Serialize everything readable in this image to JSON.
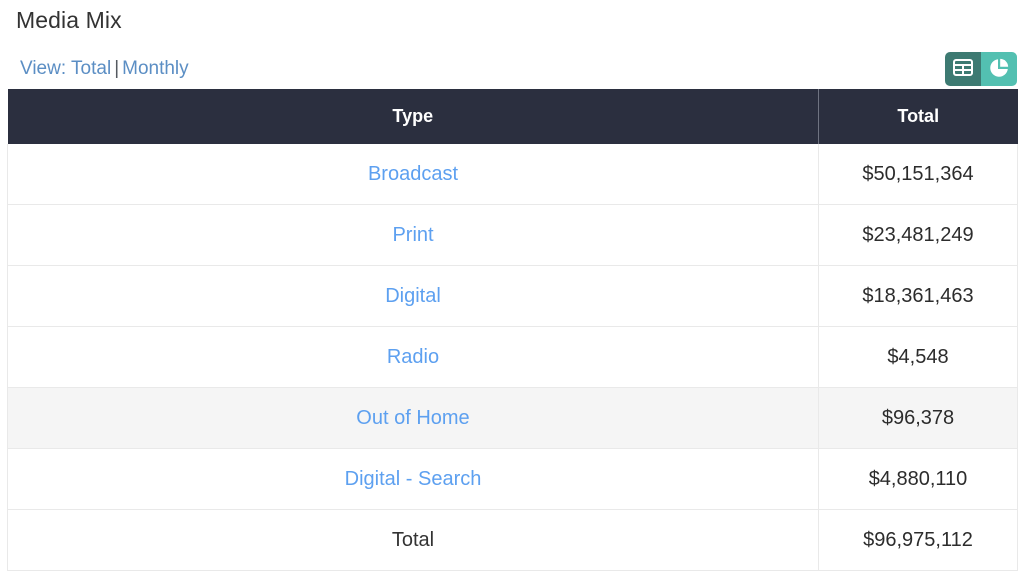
{
  "header": {
    "title": "Media Mix"
  },
  "view_switcher": {
    "prefix_label": "View: Total",
    "separator": "|",
    "monthly_label": "Monthly"
  },
  "toolbar": {
    "table_view_icon": "table-grid-icon",
    "chart_view_icon": "pie-chart-icon",
    "table_view_active": true,
    "colors": {
      "table_button_bg": "#3d7a72",
      "chart_button_bg": "#53c0b1",
      "header_bg": "#2b2f3f",
      "link_blue": "#5da0f0",
      "view_link_blue": "#5b8ec4",
      "hover_row_bg": "#f5f5f5"
    }
  },
  "table": {
    "columns": [
      "Type",
      "Total"
    ],
    "rows": [
      {
        "type": "Broadcast",
        "total": "$50,151,364",
        "is_link": true,
        "hovered": false
      },
      {
        "type": "Print",
        "total": "$23,481,249",
        "is_link": true,
        "hovered": false
      },
      {
        "type": "Digital",
        "total": "$18,361,463",
        "is_link": true,
        "hovered": false
      },
      {
        "type": "Radio",
        "total": "$4,548",
        "is_link": true,
        "hovered": false
      },
      {
        "type": "Out of Home",
        "total": "$96,378",
        "is_link": true,
        "hovered": true
      },
      {
        "type": "Digital - Search",
        "total": "$4,880,110",
        "is_link": true,
        "hovered": false
      },
      {
        "type": "Total",
        "total": "$96,975,112",
        "is_link": false,
        "hovered": false
      }
    ]
  },
  "chart_data": {
    "type": "table",
    "title": "Media Mix",
    "categories": [
      "Broadcast",
      "Print",
      "Digital",
      "Radio",
      "Out of Home",
      "Digital - Search"
    ],
    "values": [
      50151364,
      23481249,
      18361463,
      4548,
      96378,
      4880110
    ],
    "total": 96975112,
    "xlabel": "Type",
    "ylabel": "Total",
    "currency": "USD"
  }
}
